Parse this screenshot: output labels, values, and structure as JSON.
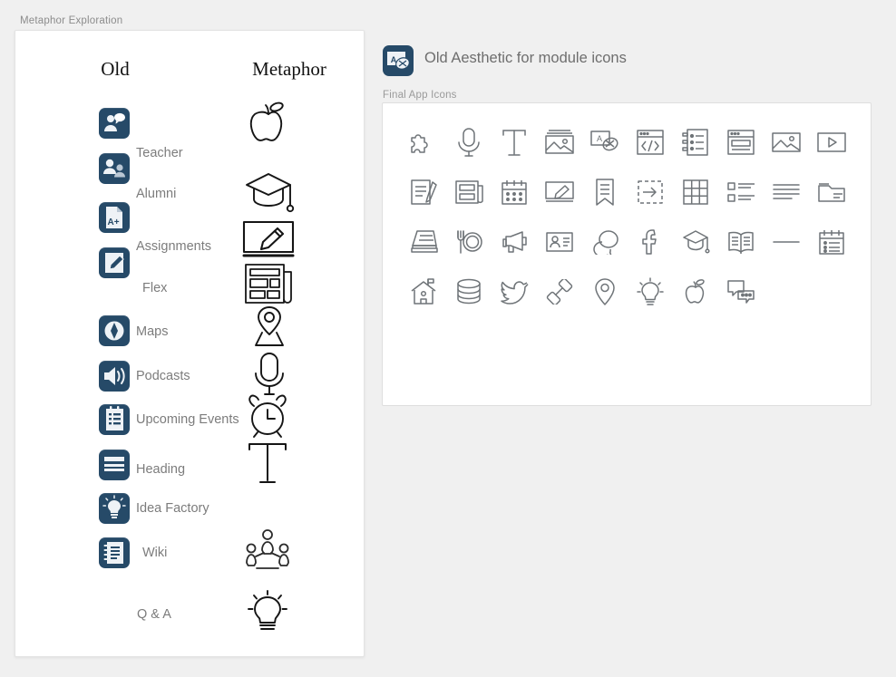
{
  "page": {
    "title": "Metaphor Exploration",
    "background": "#f0f0f0",
    "accent_navy": "#264a68",
    "label_gray": "#7c7c7c",
    "outline_gray": "#6f7478"
  },
  "left_panel": {
    "columns": {
      "old": "Old",
      "metaphor": "Metaphor"
    },
    "rows": [
      {
        "label": "Teacher",
        "old_icon": "teacher-icon",
        "metaphor_icon": "apple-icon",
        "has_old": true,
        "has_metaphor": true,
        "boxed": false
      },
      {
        "label": "Alumni",
        "old_icon": "alumni-icon",
        "metaphor_icon": "graduation-cap-icon",
        "has_old": true,
        "has_metaphor": true,
        "boxed": false
      },
      {
        "label": "Assignments",
        "old_icon": "assignments-icon",
        "metaphor_icon": "whiteboard-pencil-icon",
        "has_old": true,
        "has_metaphor": true,
        "boxed": true
      },
      {
        "label": "Flex",
        "old_icon": "flex-icon",
        "metaphor_icon": "newspaper-icon",
        "has_old": true,
        "has_metaphor": true,
        "boxed": false
      },
      {
        "label": "Maps",
        "old_icon": "maps-icon",
        "metaphor_icon": "map-pin-icon",
        "has_old": true,
        "has_metaphor": true,
        "boxed": false
      },
      {
        "label": "Podcasts",
        "old_icon": "podcasts-icon",
        "metaphor_icon": "microphone-icon",
        "has_old": true,
        "has_metaphor": true,
        "boxed": false
      },
      {
        "label": "Upcoming Events",
        "old_icon": "upcoming-events-icon",
        "metaphor_icon": "alarm-clock-icon",
        "has_old": true,
        "has_metaphor": true,
        "boxed": false
      },
      {
        "label": "Heading",
        "old_icon": "heading-icon",
        "metaphor_icon": "text-t-icon",
        "has_old": true,
        "has_metaphor": true,
        "boxed": false
      },
      {
        "label": "Idea Factory",
        "old_icon": "idea-factory-icon",
        "metaphor_icon": "",
        "has_old": true,
        "has_metaphor": false,
        "boxed": false
      },
      {
        "label": "Wiki",
        "old_icon": "wiki-icon",
        "metaphor_icon": "people-group-icon",
        "has_old": true,
        "has_metaphor": true,
        "boxed": false
      },
      {
        "label": "Q & A",
        "old_icon": "",
        "metaphor_icon": "lightbulb-icon",
        "has_old": false,
        "has_metaphor": true,
        "boxed": false
      }
    ]
  },
  "right_panel": {
    "header_icon": "translate-icon",
    "header_title": "Old Aesthetic for module icons",
    "grid_caption": "Final App Icons",
    "grid_icons": [
      "puzzle-piece-icon",
      "microphone-icon",
      "text-t-icon",
      "image-frame-icon",
      "translate-icon",
      "code-window-icon",
      "notebook-list-icon",
      "browser-window-icon",
      "landscape-image-icon",
      "video-play-icon",
      "document-pencil-icon",
      "newspaper-icon",
      "calendar-icon",
      "whiteboard-pencil-icon",
      "bookmark-icon",
      "dashed-arrow-icon",
      "grid-table-icon",
      "checklist-icon",
      "text-lines-icon",
      "folder-icon",
      "book-stack-icon",
      "dining-plate-icon",
      "megaphone-icon",
      "id-card-icon",
      "speech-bubbles-icon",
      "facebook-icon",
      "graduation-cap-icon",
      "open-book-icon",
      "horizontal-rule-icon",
      "calendar-list-icon",
      "school-house-icon",
      "database-icon",
      "twitter-bird-icon",
      "link-chain-icon",
      "map-pin-icon",
      "lightbulb-icon",
      "apple-icon",
      "chat-bubbles-icon"
    ]
  }
}
